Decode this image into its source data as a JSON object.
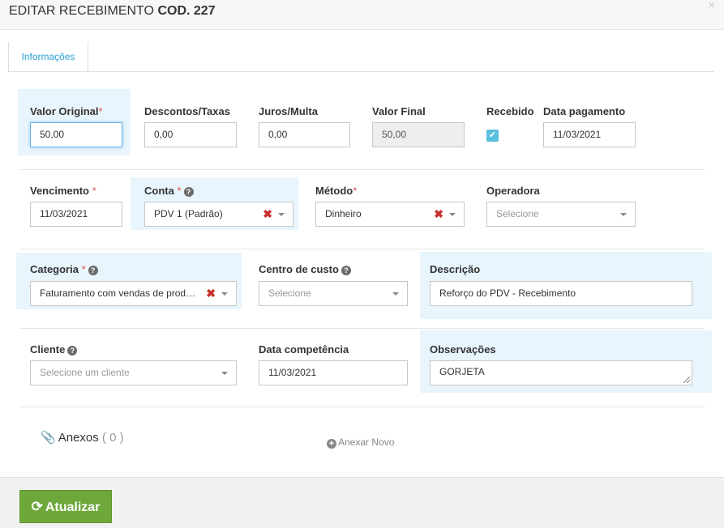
{
  "header": {
    "title_prefix": "EDITAR RECEBIMENTO",
    "title_code": "COD. 227",
    "close": "×"
  },
  "tabs": [
    {
      "label": "Informações",
      "active": true
    }
  ],
  "row1": {
    "valor_original": {
      "label": "Valor Original",
      "required": "*",
      "value": "50,00"
    },
    "descontos": {
      "label": "Descontos/Taxas",
      "value": "0,00"
    },
    "juros": {
      "label": "Juros/Multa",
      "value": "0,00"
    },
    "valor_final": {
      "label": "Valor Final",
      "value": "50,00"
    },
    "recebido": {
      "label": "Recebido",
      "checked": true
    },
    "data_pagamento": {
      "label": "Data pagamento",
      "value": "11/03/2021"
    }
  },
  "row2": {
    "vencimento": {
      "label": "Vencimento",
      "required": "*",
      "value": "11/03/2021"
    },
    "conta": {
      "label": "Conta",
      "required": "*",
      "value": "PDV 1 (Padrão)"
    },
    "metodo": {
      "label": "Método",
      "required": "*",
      "value": "Dinheiro"
    },
    "operadora": {
      "label": "Operadora",
      "placeholder": "Selecione"
    }
  },
  "row3": {
    "categoria": {
      "label": "Categoria",
      "required": "*",
      "value": "Faturamento com vendas de prod…"
    },
    "centro_custo": {
      "label": "Centro de custo",
      "placeholder": "Selecione"
    },
    "descricao": {
      "label": "Descrição",
      "value": "Reforço do PDV - Recebimento"
    }
  },
  "row4": {
    "cliente": {
      "label": "Cliente",
      "placeholder": "Selecione um cliente"
    },
    "data_competencia": {
      "label": "Data competência",
      "value": "11/03/2021"
    },
    "observacoes": {
      "label": "Observações",
      "value": "GORJETA"
    }
  },
  "anexos": {
    "label": "Anexos",
    "count": "( 0 )",
    "add_label": "Anexar Novo"
  },
  "footer": {
    "update_label": "Atualizar"
  },
  "icons": {
    "clear": "✖",
    "help": "?",
    "check": "✔",
    "refresh": "⟳",
    "clip": "📎",
    "plus": "+"
  },
  "colors": {
    "accent": "#2a9fd6",
    "highlight": "#e8f5fc",
    "button": "#6ea83a",
    "error": "#c9302c"
  }
}
